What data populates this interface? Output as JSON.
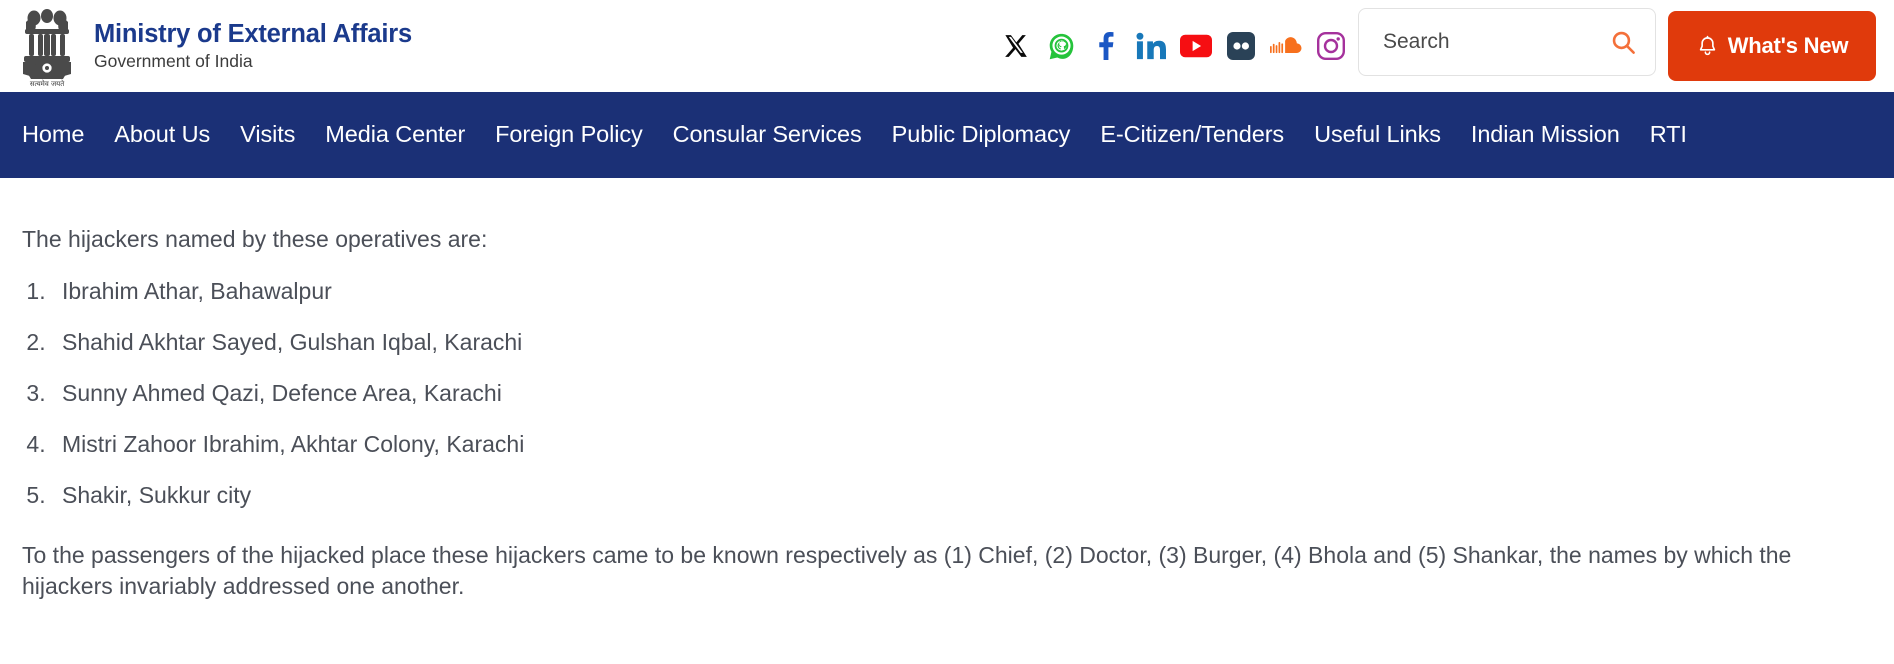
{
  "header": {
    "emblem_alt": "State Emblem of India",
    "emblem_motto": "सत्यमेव जयते",
    "title": "Ministry of External Affairs",
    "subtitle": "Government of India",
    "social_links": [
      {
        "name": "x-twitter",
        "label": "X"
      },
      {
        "name": "whatsapp",
        "label": "WhatsApp"
      },
      {
        "name": "facebook",
        "label": "Facebook"
      },
      {
        "name": "linkedin",
        "label": "LinkedIn"
      },
      {
        "name": "youtube",
        "label": "YouTube"
      },
      {
        "name": "flickr",
        "label": "Flickr"
      },
      {
        "name": "soundcloud",
        "label": "SoundCloud"
      },
      {
        "name": "instagram",
        "label": "Instagram"
      }
    ],
    "search": {
      "placeholder": "Search",
      "value": ""
    },
    "whats_new_label": "What's New"
  },
  "nav": {
    "items": [
      {
        "label": "Home"
      },
      {
        "label": "About Us"
      },
      {
        "label": "Visits"
      },
      {
        "label": "Media Center"
      },
      {
        "label": "Foreign Policy"
      },
      {
        "label": "Consular Services"
      },
      {
        "label": "Public Diplomacy"
      },
      {
        "label": "E-Citizen/Tenders"
      },
      {
        "label": "Useful Links"
      },
      {
        "label": "Indian Mission"
      },
      {
        "label": "RTI"
      }
    ]
  },
  "main": {
    "intro": "The hijackers named by these operatives are:",
    "hijackers": [
      "Ibrahim Athar, Bahawalpur",
      "Shahid Akhtar Sayed, Gulshan Iqbal, Karachi",
      "Sunny Ahmed Qazi, Defence Area, Karachi",
      "Mistri Zahoor Ibrahim, Akhtar Colony, Karachi",
      "Shakir, Sukkur city"
    ],
    "closing": "To the passengers of the hijacked place these hijackers came to be known respectively as (1) Chief, (2) Doctor, (3) Burger, (4) Bhola and (5) Shankar, the names by which the hijackers invariably addressed one another."
  },
  "colors": {
    "nav_background": "#1B3076",
    "brand_blue": "#1B3A8C",
    "accent_orange": "#E03A0C",
    "search_icon": "#F4703A",
    "body_text": "#4B4F58"
  }
}
